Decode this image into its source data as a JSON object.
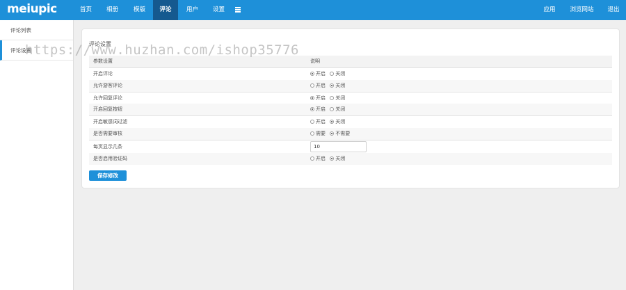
{
  "app": {
    "logo": "meiupic"
  },
  "nav": {
    "items": [
      {
        "label": "首页"
      },
      {
        "label": "相册"
      },
      {
        "label": "模版"
      },
      {
        "label": "评论"
      },
      {
        "label": "用户"
      },
      {
        "label": "设置"
      }
    ],
    "active_index": 3,
    "right": [
      {
        "label": "应用"
      },
      {
        "label": "浏览网站"
      },
      {
        "label": "退出"
      }
    ]
  },
  "sidebar": {
    "items": [
      {
        "label": "评论列表"
      },
      {
        "label": "评论设置"
      }
    ],
    "active_index": 1
  },
  "settings": {
    "title": "评论设置",
    "header": {
      "param": "参数设置",
      "desc": "说明"
    },
    "rows": [
      {
        "label": "开启评论",
        "options": [
          "开启",
          "关闭"
        ],
        "selected": 0
      },
      {
        "label": "允许游客评论",
        "options": [
          "开启",
          "关闭"
        ],
        "selected": 1
      },
      {
        "label": "允许回复评论",
        "options": [
          "开启",
          "关闭"
        ],
        "selected": 0
      },
      {
        "label": "开启回复按钮",
        "options": [
          "开启",
          "关闭"
        ],
        "selected": 0
      },
      {
        "label": "开启敏感词过滤",
        "options": [
          "开启",
          "关闭"
        ],
        "selected": 1
      },
      {
        "label": "是否需要审核",
        "options": [
          "需要",
          "不需要"
        ],
        "selected": 1
      },
      {
        "label": "每页显示几条",
        "value": "10"
      },
      {
        "label": "是否启用验证码",
        "options": [
          "开启",
          "关闭"
        ],
        "selected": 1
      }
    ],
    "save_label": "保存修改"
  },
  "watermark": "https://www.huzhan.com/ishop35776"
}
